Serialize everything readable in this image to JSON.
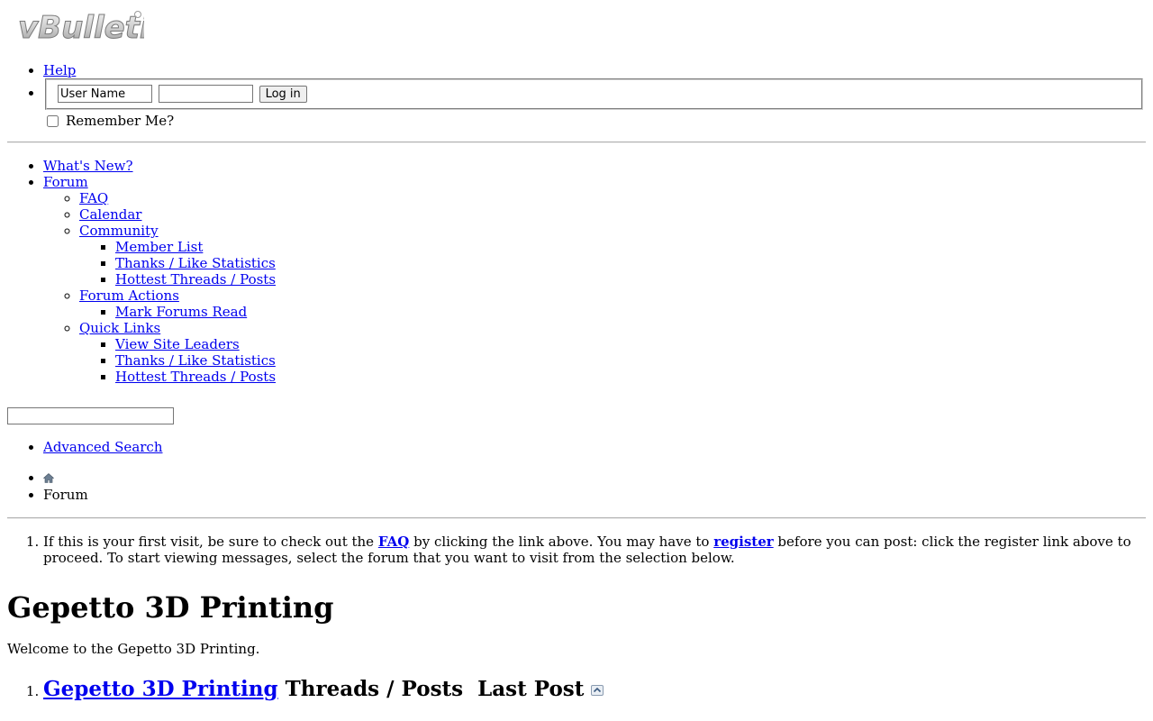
{
  "logo": {
    "alt_text": "vBulletin"
  },
  "top_nav": {
    "help_label": "Help",
    "login": {
      "username_value": "User Name",
      "password_value": "",
      "login_button": "Log in",
      "remember_label": "Remember Me?"
    }
  },
  "main_nav": {
    "whats_new": "What's New?",
    "forum": "Forum",
    "faq": "FAQ",
    "calendar": "Calendar",
    "community": {
      "label": "Community",
      "items": [
        "Member List",
        "Thanks / Like Statistics",
        "Hottest Threads / Posts"
      ]
    },
    "forum_actions": {
      "label": "Forum Actions",
      "items": [
        "Mark Forums Read"
      ]
    },
    "quick_links": {
      "label": "Quick Links",
      "items": [
        "View Site Leaders",
        "Thanks / Like Statistics",
        "Hottest Threads / Posts"
      ]
    }
  },
  "search": {
    "value": "",
    "advanced_label": "Advanced Search"
  },
  "breadcrumb": {
    "home_icon": "home-icon",
    "current": "Forum"
  },
  "notice": {
    "text_1": "If this is your first visit, be sure to check out the ",
    "faq_link": "FAQ",
    "text_2": " by clicking the link above. You may have to ",
    "register_link": "register",
    "text_3": " before you can post: click the register link above to proceed. To start viewing messages, select the forum that you want to visit from the selection below."
  },
  "page_title": "Gepetto 3D Printing",
  "welcome_text": "Welcome to the Gepetto 3D Printing.",
  "forum_header": {
    "forum_link": "Gepetto 3D Printing",
    "threads_posts": "Threads / Posts",
    "last_post": "Last Post",
    "collapse_icon": "collapse-icon"
  },
  "colors": {
    "link": "#0000ee",
    "text": "#000000",
    "background": "#ffffff"
  }
}
